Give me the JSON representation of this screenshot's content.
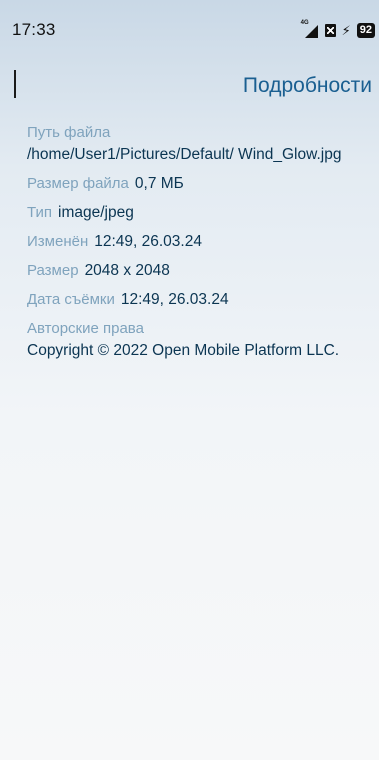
{
  "status_bar": {
    "time": "17:33",
    "network_label": "4G",
    "battery": "92"
  },
  "header": {
    "title": "Подробности"
  },
  "details": {
    "path_label": "Путь файла",
    "path_value": "/home/User1/Pictures/Default/ Wind_Glow.jpg",
    "size_label": "Размер файла",
    "size_value": "0,7 МБ",
    "type_label": "Тип",
    "type_value": "image/jpeg",
    "modified_label": "Изменён",
    "modified_value": "12:49, 26.03.24",
    "dimensions_label": "Размер",
    "dimensions_value": "2048 x 2048",
    "taken_label": "Дата съёмки",
    "taken_value": "12:49, 26.03.24",
    "copyright_label": "Авторские права",
    "copyright_value": "Copyright © 2022  Open Mobile Platform LLC."
  },
  "icons": {
    "network": "signal-4g-icon",
    "sim": "sim-off-icon",
    "charging": "charging-bolt-icon",
    "battery": "battery-icon"
  }
}
